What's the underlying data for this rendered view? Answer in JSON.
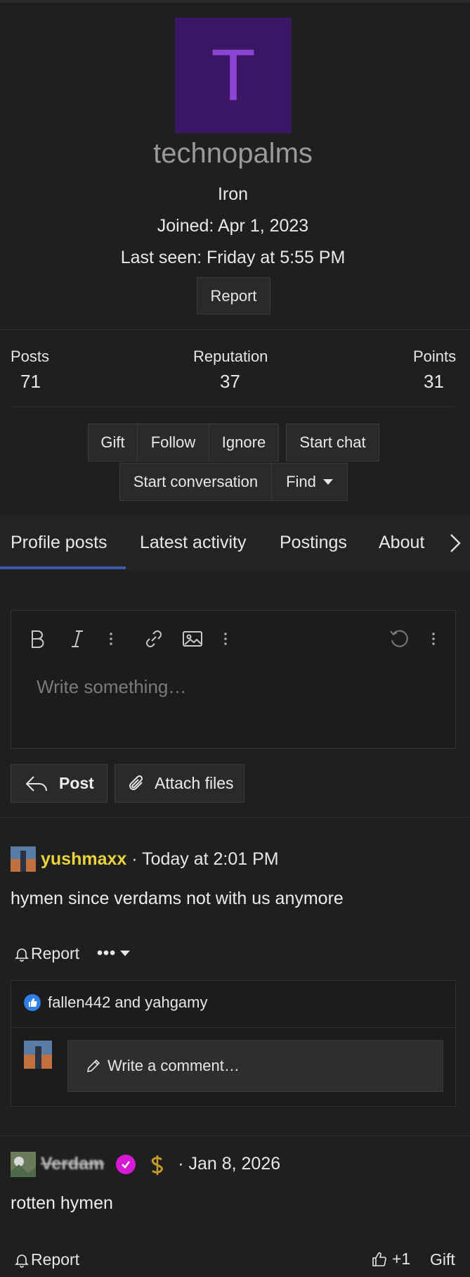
{
  "profile": {
    "avatar_letter": "T",
    "username": "technopalms",
    "rank": "Iron",
    "joined": "Joined: Apr 1, 2023",
    "last_seen": "Last seen: Friday at 5:55 PM",
    "report_label": "Report",
    "avatar_bg": "#3a1765",
    "avatar_fg": "#8a45d6"
  },
  "stats": [
    {
      "label": "Posts",
      "value": "71"
    },
    {
      "label": "Reputation",
      "value": "37"
    },
    {
      "label": "Points",
      "value": "31"
    }
  ],
  "actions": {
    "gift": "Gift",
    "follow": "Follow",
    "ignore": "Ignore",
    "start_chat": "Start chat",
    "start_conversation": "Start conversation",
    "find": "Find"
  },
  "tabs": [
    {
      "label": "Profile posts",
      "active": true
    },
    {
      "label": "Latest activity"
    },
    {
      "label": "Postings"
    },
    {
      "label": "About"
    }
  ],
  "editor": {
    "placeholder": "Write something…",
    "post_label": "Post",
    "attach_label": "Attach files"
  },
  "posts": [
    {
      "author": "yushmaxx",
      "time": "· Today at 2:01 PM",
      "body": "hymen since verdams not with us anymore",
      "report_label": "Report",
      "more_label": "•••",
      "reactions": "fallen442 and yahgamy",
      "comment_placeholder": "Write a comment…"
    },
    {
      "author": "Verdam",
      "time": "· Jan 8, 2026",
      "body": "rotten hymen",
      "report_label": "Report",
      "like_count": "+1",
      "gift_label": "Gift"
    }
  ],
  "colors": {
    "background": "#1f1f1f",
    "accent_tab": "#3a5bab",
    "author_highlight": "#e8d33a",
    "verified_badge": "#d61ad3",
    "like_badge": "#2f7fe8"
  }
}
